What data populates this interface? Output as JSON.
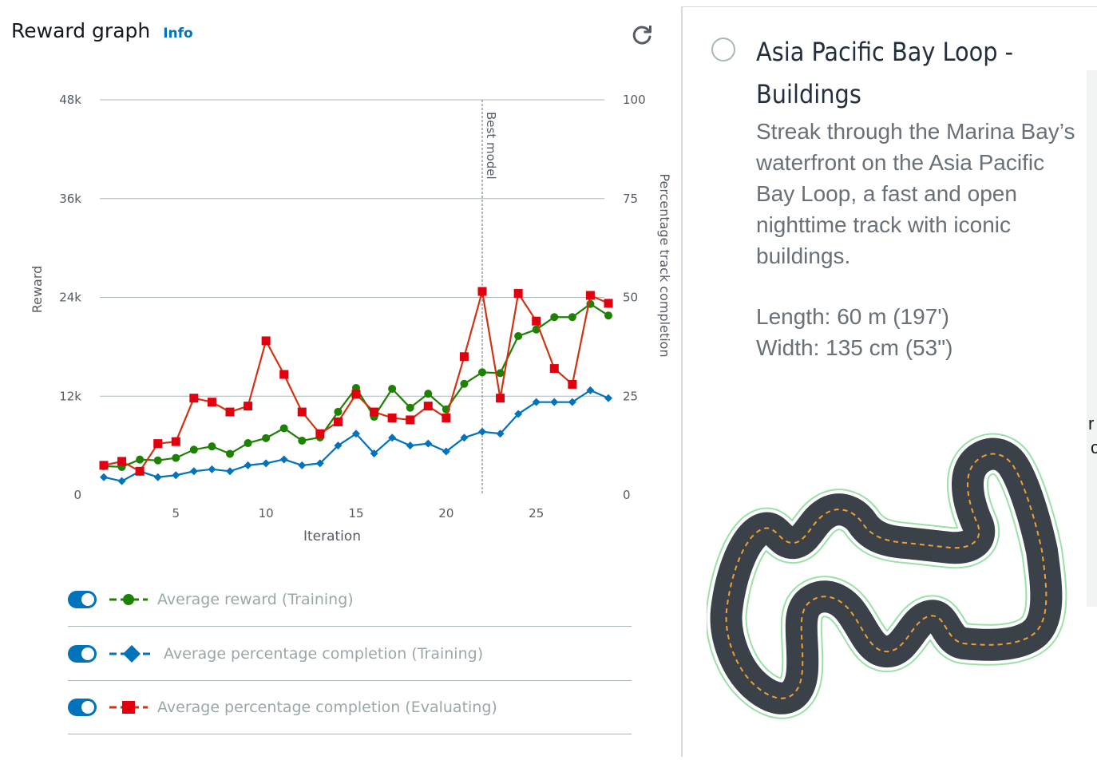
{
  "header": {
    "title": "Reward graph",
    "info_link": "Info",
    "refresh_icon": "refresh-icon"
  },
  "chart_data": {
    "type": "line",
    "xlabel": "Iteration",
    "ylabel_left": "Reward",
    "ylabel_right": "Percentage track completion",
    "x_ticks": [
      5,
      10,
      15,
      20,
      25
    ],
    "y_left_ticks": [
      "0",
      "12k",
      "24k",
      "36k",
      "48k"
    ],
    "y_right_ticks": [
      "0",
      "25",
      "50",
      "75",
      "100"
    ],
    "y_left_lim": [
      0,
      48000
    ],
    "y_right_lim": [
      0,
      100
    ],
    "x_lim": [
      1,
      29
    ],
    "grid": true,
    "annotation": {
      "label": "Best model",
      "x": 22
    },
    "x": [
      1,
      2,
      3,
      4,
      5,
      6,
      7,
      8,
      9,
      10,
      11,
      12,
      13,
      14,
      15,
      16,
      17,
      18,
      19,
      20,
      21,
      22,
      23,
      24,
      25,
      26,
      27,
      28,
      29
    ],
    "series": [
      {
        "name": "Average reward (Training)",
        "axis": "left",
        "color": "#1d8102",
        "marker": "circle",
        "values": [
          3500,
          3400,
          4300,
          4200,
          4500,
          5500,
          5900,
          5000,
          6300,
          6900,
          8100,
          6600,
          7000,
          10100,
          13000,
          9500,
          12900,
          10600,
          12300,
          10400,
          13500,
          14900,
          14800,
          19300,
          20100,
          21600,
          21600,
          23200,
          21800
        ]
      },
      {
        "name": "Average percentage completion (Training)",
        "axis": "right",
        "color": "#0073bb",
        "marker": "diamond",
        "values": [
          4.5,
          3.5,
          6.0,
          4.5,
          5.0,
          6.0,
          6.5,
          6.0,
          7.5,
          8.0,
          9.0,
          7.5,
          8.0,
          12.5,
          15.5,
          10.5,
          14.5,
          12.5,
          13.0,
          11.0,
          14.5,
          16.0,
          15.5,
          20.5,
          23.5,
          23.5,
          23.5,
          26.5,
          24.5
        ]
      },
      {
        "name": "Average percentage completion (Evaluating)",
        "axis": "right",
        "color": "#d13212",
        "marker": "square",
        "values": [
          7.5,
          8.5,
          6.0,
          13.0,
          13.5,
          24.5,
          23.5,
          21.0,
          22.5,
          39.0,
          30.5,
          21.0,
          15.5,
          18.5,
          25.5,
          21.0,
          19.5,
          19.0,
          22.5,
          19.5,
          35.0,
          51.5,
          24.5,
          51.0,
          44.0,
          32.0,
          28.0,
          50.5,
          48.5
        ]
      }
    ]
  },
  "legend": [
    {
      "label": "Average reward (Training)",
      "color": "#1d8102",
      "marker": "circle",
      "enabled": true
    },
    {
      "label": "Average percentage completion (Training)",
      "color": "#0073bb",
      "marker": "diamond",
      "enabled": true
    },
    {
      "label": "Average percentage completion (Evaluating)",
      "color": "#d13212",
      "marker": "square",
      "enabled": true
    }
  ],
  "track": {
    "name": "Asia Pacific Bay Loop - Buildings",
    "description": "Streak through the Marina Bay’s waterfront on the Asia Pacific Bay Loop, a fast and open nighttime track with iconic buildings.",
    "length": "Length: 60 m (197')",
    "width": "Width: 135 cm (53\")",
    "selected": false
  },
  "edge_fragment": {
    "line1": "r",
    "line2": "c"
  }
}
